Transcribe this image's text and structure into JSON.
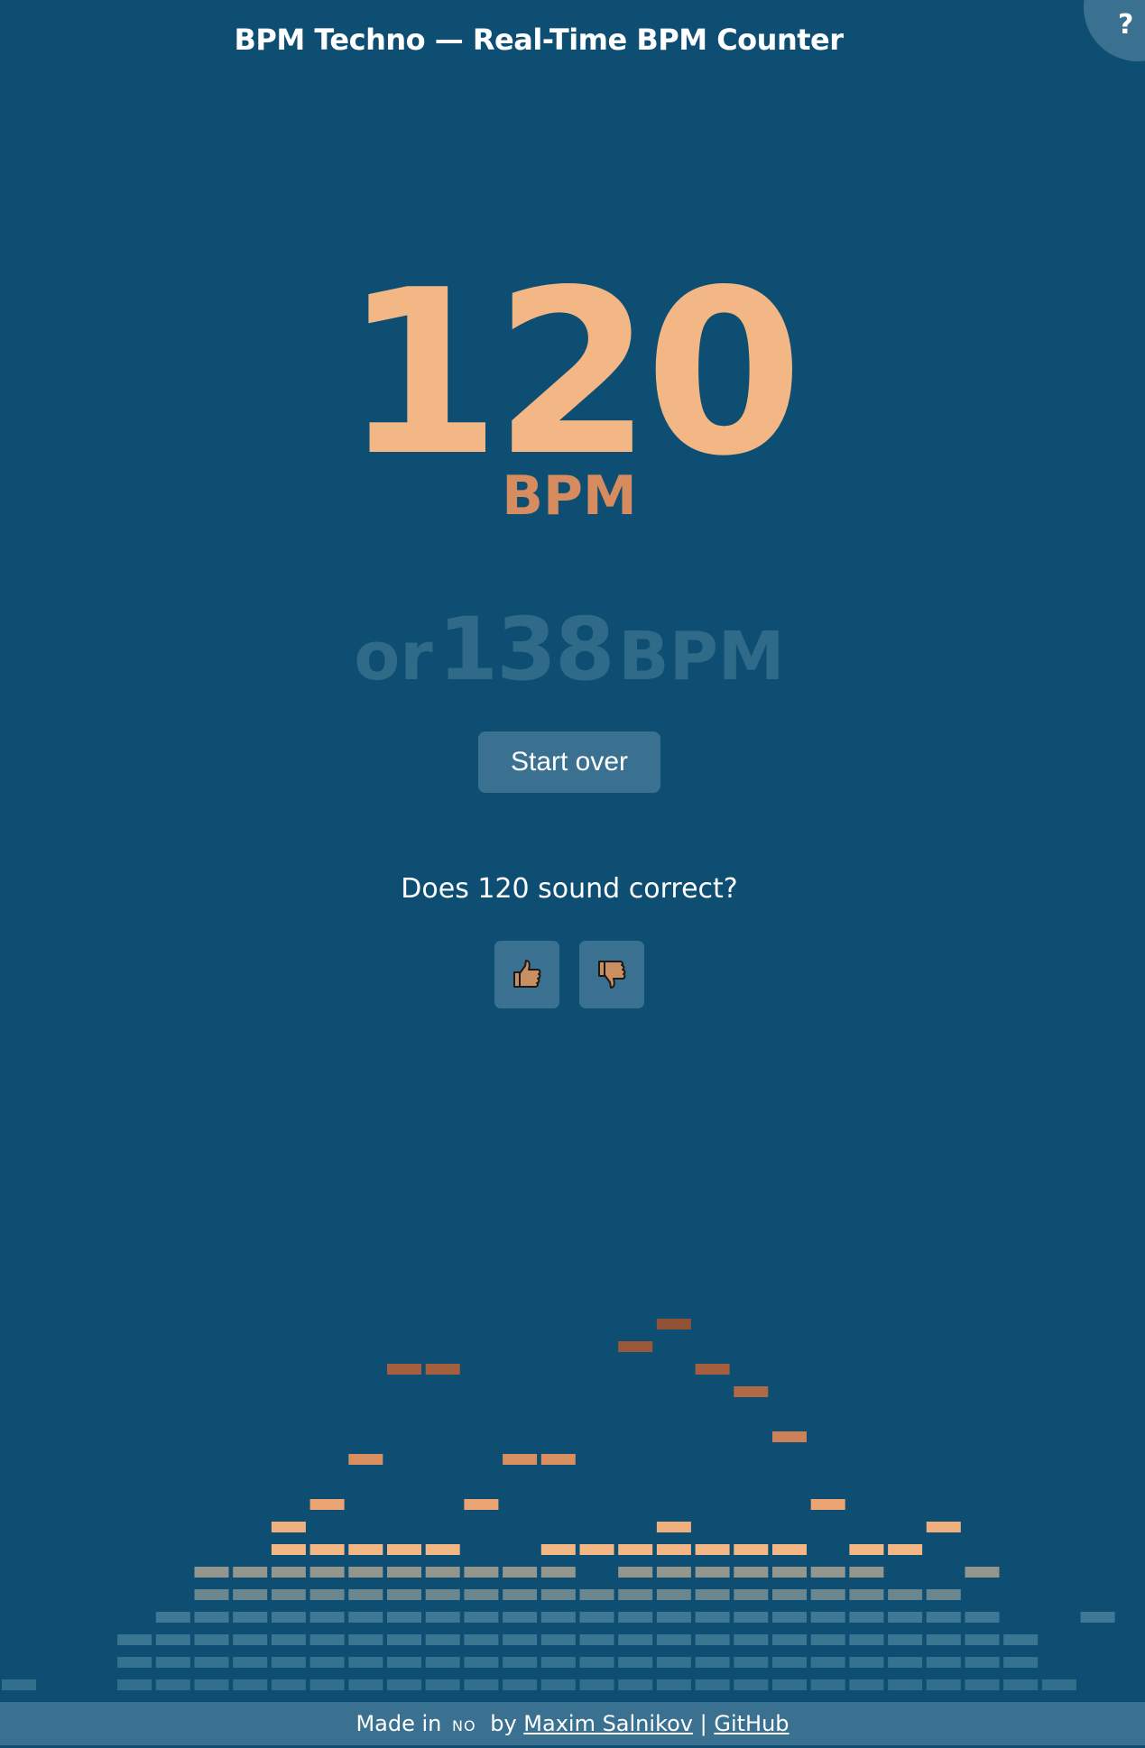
{
  "header": {
    "title": "BPM Techno — Real-Time BPM Counter",
    "help_label": "?"
  },
  "result": {
    "bpm": "120",
    "unit": "BPM",
    "alt_prefix": "or",
    "alt_bpm": "138",
    "alt_unit": "BPM"
  },
  "actions": {
    "start_over_label": "Start over"
  },
  "feedback": {
    "question": "Does 120 sound correct?",
    "thumbs_up_icon": "thumbs-up-icon",
    "thumbs_down_icon": "thumbs-down-icon"
  },
  "footer": {
    "made_in": "Made in",
    "flag": "NO",
    "by": "by",
    "author": "Maxim Salnikov",
    "separator": "|",
    "github": "GitHub"
  },
  "colors": {
    "background": "#0e4e73",
    "accent": "#f2b784",
    "unit": "#d68c5e",
    "alt": "#2f6a88",
    "button": "#3b7190"
  },
  "visualizer": {
    "peak_levels": [
      1,
      0,
      0,
      3,
      4,
      6,
      6,
      8,
      9,
      11,
      15,
      15,
      9,
      11,
      11,
      7,
      16,
      17,
      15,
      14,
      12,
      9,
      7,
      7,
      8,
      6,
      3,
      1,
      4
    ],
    "bar_levels": [
      1,
      0,
      0,
      3,
      4,
      5,
      6,
      7,
      7,
      7,
      7,
      7,
      6,
      6,
      7,
      5,
      7,
      8,
      7,
      7,
      7,
      6,
      6,
      5,
      5,
      4,
      3,
      0,
      0
    ]
  }
}
